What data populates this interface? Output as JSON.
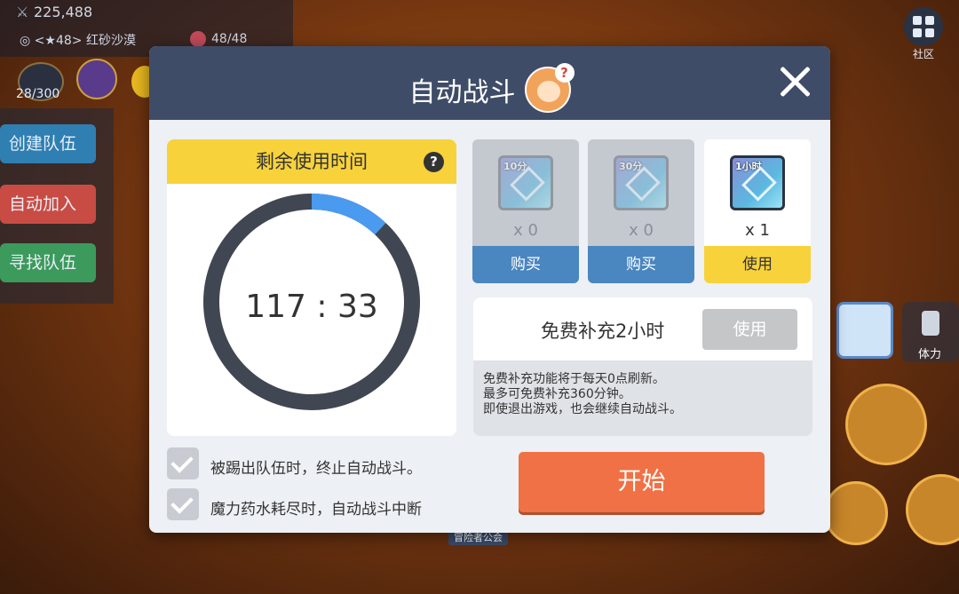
{
  "hud": {
    "power": "225,488",
    "location": "<★48> 红砂沙漠",
    "hp": "48/48",
    "resource": "28/300",
    "community": "社区",
    "guild_tag": "冒险者公会"
  },
  "side_menu": {
    "items": [
      {
        "label": "创建队伍",
        "color": "#2f7fb3"
      },
      {
        "label": "自动加入",
        "color": "#c84c44"
      },
      {
        "label": "寻找队伍",
        "color": "#3c9a5c"
      }
    ]
  },
  "right_hud": {
    "stamina": "体力"
  },
  "modal": {
    "title": "自动战斗",
    "avatar_badge": "?",
    "remaining": {
      "label": "剩余使用时间",
      "help": "?",
      "timer": "117 : 33",
      "progress": 0.12
    },
    "options": [
      {
        "label": "被踢出队伍时，终止自动战斗。",
        "checked": true
      },
      {
        "label": "魔力药水耗尽时，自动战斗中断",
        "checked": true
      }
    ],
    "items": [
      {
        "badge": "10分",
        "qty": "x 0",
        "button": "购买",
        "state": "gray"
      },
      {
        "badge": "30分",
        "qty": "x 0",
        "button": "购买",
        "state": "gray"
      },
      {
        "badge": "1小时",
        "qty": "x 1",
        "button": "使用",
        "state": "active"
      }
    ],
    "free": {
      "label": "免费补充2小时",
      "button": "使用",
      "info": [
        "免费补充功能将于每天0点刷新。",
        "最多可免费补充360分钟。",
        "即使退出游戏，也会继续自动战斗。"
      ]
    },
    "start_button": "开始"
  },
  "colors": {
    "header": "#3f4c67",
    "accent_yellow": "#f7d23b",
    "progress_blue": "#4a9af0",
    "ring_dark": "#404652",
    "start_orange": "#f07145",
    "buy_blue": "#4a86c0"
  }
}
